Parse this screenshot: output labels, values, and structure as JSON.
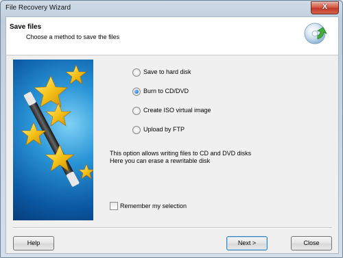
{
  "window": {
    "title": "File Recovery Wizard",
    "close_symbol": "X"
  },
  "header": {
    "title": "Save files",
    "subtitle": "Choose a method to save the files",
    "icon": "disc-save-icon"
  },
  "options": [
    {
      "label": "Save to hard disk",
      "selected": false
    },
    {
      "label": "Burn to CD/DVD",
      "selected": true
    },
    {
      "label": "Create ISO virtual image",
      "selected": false
    },
    {
      "label": "Upload by FTP",
      "selected": false
    }
  ],
  "description": {
    "line1": "This option allows writing files to CD and DVD disks",
    "line2": "Here you can erase a rewritable disk"
  },
  "remember": {
    "label": "Remember my selection",
    "checked": false
  },
  "buttons": {
    "help": "Help",
    "next": "Next >",
    "close": "Close"
  }
}
